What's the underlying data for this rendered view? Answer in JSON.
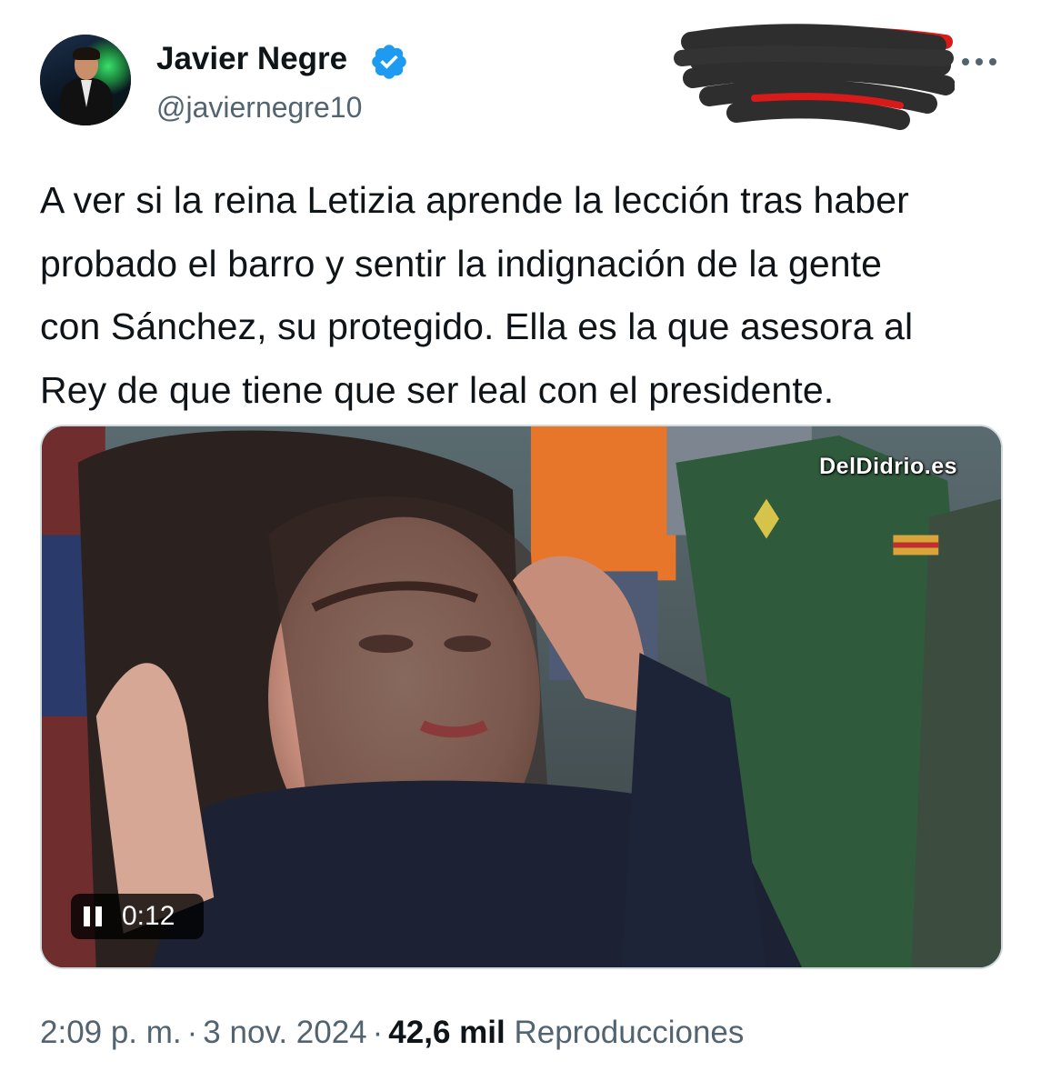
{
  "author": {
    "name": "Javier Negre",
    "handle": "@javiernegre10",
    "verified": true,
    "avatar_icon": "profile-photo"
  },
  "menu_icon": "more-options-icon",
  "tweet": {
    "text": "A ver si la reina Letizia aprende la lección tras haber\nprobado el barro y sentir la indignación de la gente\ncon Sánchez, su protegido. Ella es la que asesora al\nRey de que tiene que ser leal con el presidente."
  },
  "video": {
    "watermark": "DelDidrio.es",
    "time": "0:12",
    "state": "playing"
  },
  "meta": {
    "time": "2:09 p. m.",
    "separator": "·",
    "date": "3 nov. 2024",
    "views_count": "42,6 mil",
    "views_label": "Reproducciones"
  },
  "colors": {
    "text": "#0f1419",
    "secondary": "#536471",
    "verified_blue": "#1d9bf0",
    "border": "#cfd9de"
  }
}
